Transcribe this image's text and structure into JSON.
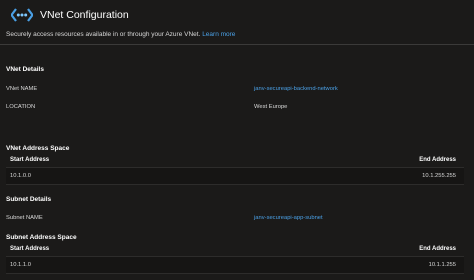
{
  "header": {
    "title": "VNet Configuration",
    "icon": "vnet-icon",
    "icon_color": "#4aa0e6"
  },
  "description": {
    "text": "Securely access resources available in or through your Azure VNet.",
    "link": "Learn more"
  },
  "vnet_details": {
    "title": "VNet Details",
    "name_label": "VNet NAME",
    "name_value": "janv-secureapi-backend-network",
    "location_label": "LOCATION",
    "location_value": "West Europe"
  },
  "vnet_address_space": {
    "title": "VNet Address Space",
    "columns": [
      "Start Address",
      "End Address"
    ],
    "rows": [
      {
        "start": "10.1.0.0",
        "end": "10.1.255.255"
      }
    ]
  },
  "subnet_details": {
    "title": "Subnet Details",
    "name_label": "Subnet NAME",
    "name_value": "janv-secureapi-app-subnet"
  },
  "subnet_address_space": {
    "title": "Subnet Address Space",
    "columns": [
      "Start Address",
      "End Address"
    ],
    "rows": [
      {
        "start": "10.1.1.0",
        "end": "10.1.1.255"
      }
    ]
  },
  "colors": {
    "background": "#1b1a19",
    "link": "#4aa0e6",
    "text": "#d8d8d8"
  }
}
